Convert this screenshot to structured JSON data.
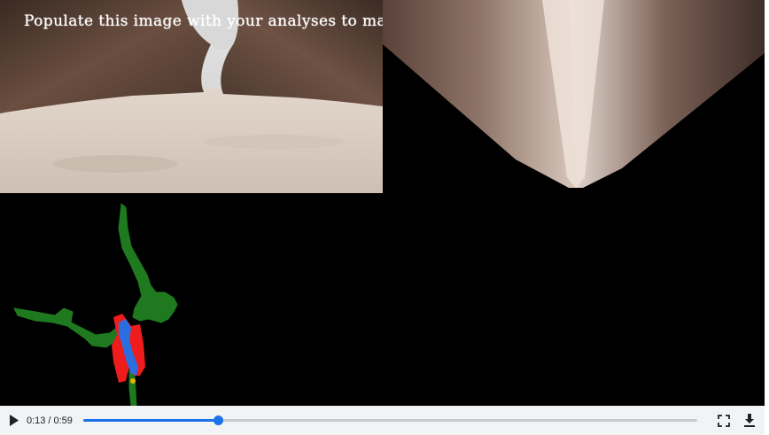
{
  "video": {
    "overlay_text": "Populate this image with your analyses to make a video!",
    "panels": [
      "camera-view",
      "warped-perspective-view",
      "worldmap-view"
    ]
  },
  "controls": {
    "current_time": "0:13",
    "separator": "/",
    "duration": "0:59",
    "progress_fraction": 0.22,
    "accent_color": "#1a73e8",
    "play_icon": "play-icon",
    "fullscreen_icon": "fullscreen-icon",
    "download_icon": "download-icon"
  }
}
